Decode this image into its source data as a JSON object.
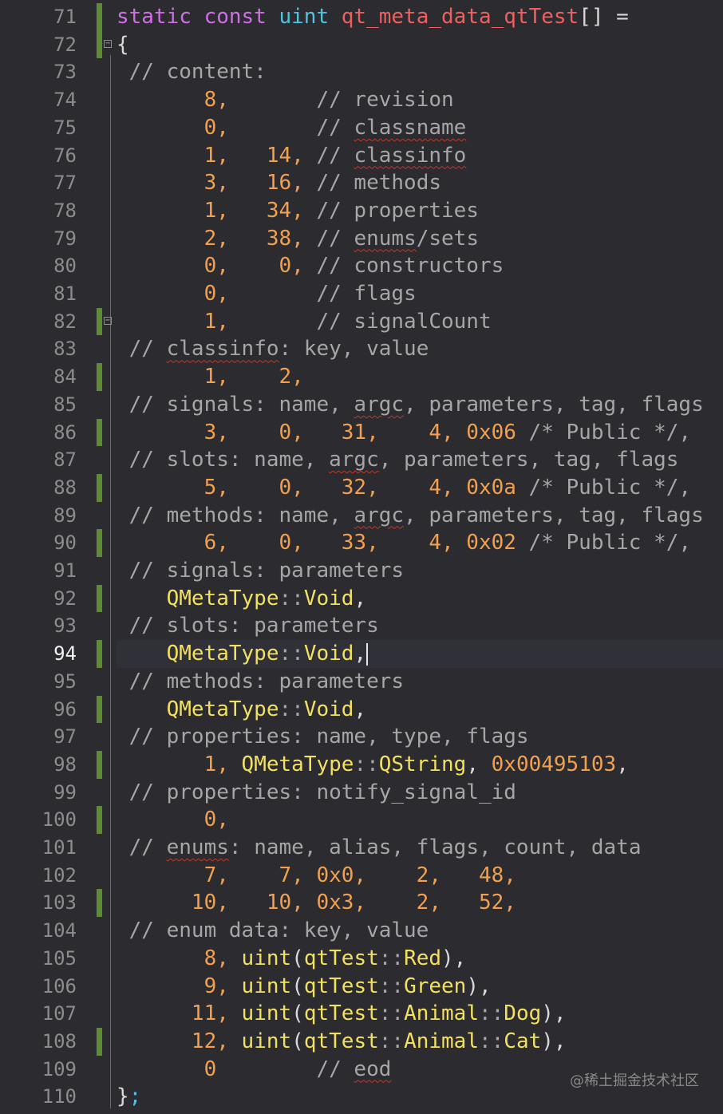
{
  "editor": {
    "current_line": 94,
    "lines": [
      {
        "n": 71,
        "mod": true,
        "tokens": [
          [
            "kw",
            "static const "
          ],
          [
            "ty",
            "uint "
          ],
          [
            "fn",
            "qt_meta_data_qtTest"
          ],
          [
            "punct",
            "[] ="
          ]
        ]
      },
      {
        "n": 72,
        "mod": true,
        "fold": true,
        "tokens": [
          [
            "punct",
            "{"
          ]
        ]
      },
      {
        "n": 73,
        "tokens": [
          [
            "cm",
            " // content:"
          ]
        ]
      },
      {
        "n": 74,
        "tokens": [
          [
            "num",
            "       8,"
          ],
          [
            "cm",
            "       // revision"
          ]
        ]
      },
      {
        "n": 75,
        "tokens": [
          [
            "num",
            "       0,"
          ],
          [
            "cm",
            "       // "
          ],
          [
            "cmsq",
            "classname"
          ]
        ]
      },
      {
        "n": 76,
        "tokens": [
          [
            "num",
            "       1,   14,"
          ],
          [
            "cm",
            " // "
          ],
          [
            "cmsq",
            "classinfo"
          ]
        ]
      },
      {
        "n": 77,
        "tokens": [
          [
            "num",
            "       3,   16,"
          ],
          [
            "cm",
            " // methods"
          ]
        ]
      },
      {
        "n": 78,
        "tokens": [
          [
            "num",
            "       1,   34,"
          ],
          [
            "cm",
            " // properties"
          ]
        ]
      },
      {
        "n": 79,
        "tokens": [
          [
            "num",
            "       2,   38,"
          ],
          [
            "cm",
            " // "
          ],
          [
            "cmsq",
            "enums"
          ],
          [
            "cm",
            "/sets"
          ]
        ]
      },
      {
        "n": 80,
        "tokens": [
          [
            "num",
            "       0,    0,"
          ],
          [
            "cm",
            " // constructors"
          ]
        ]
      },
      {
        "n": 81,
        "tokens": [
          [
            "num",
            "       0,"
          ],
          [
            "cm",
            "       // flags"
          ]
        ]
      },
      {
        "n": 82,
        "mod": true,
        "fold": true,
        "tokens": [
          [
            "num",
            "       1,"
          ],
          [
            "cm",
            "       // signalCount"
          ]
        ]
      },
      {
        "n": 83,
        "tokens": [
          [
            "cm",
            " // "
          ],
          [
            "cmsq",
            "classinfo"
          ],
          [
            "cm",
            ": key, value"
          ]
        ]
      },
      {
        "n": 84,
        "mod": true,
        "tokens": [
          [
            "num",
            "       1,    2,"
          ]
        ]
      },
      {
        "n": 85,
        "tokens": [
          [
            "cm",
            " // signals: name, "
          ],
          [
            "cmsq",
            "argc"
          ],
          [
            "cm",
            ", parameters, tag, flags"
          ]
        ]
      },
      {
        "n": 86,
        "mod": true,
        "tokens": [
          [
            "num",
            "       3,    0,   31,    4, 0x06"
          ],
          [
            "cm",
            " /* Public */,"
          ]
        ]
      },
      {
        "n": 87,
        "tokens": [
          [
            "cm",
            " // slots: name, "
          ],
          [
            "cmsq",
            "argc"
          ],
          [
            "cm",
            ", parameters, tag, flags"
          ]
        ]
      },
      {
        "n": 88,
        "mod": true,
        "tokens": [
          [
            "num",
            "       5,    0,   32,    4, 0x0a"
          ],
          [
            "cm",
            " /* Public */,"
          ]
        ]
      },
      {
        "n": 89,
        "tokens": [
          [
            "cm",
            " // methods: name, "
          ],
          [
            "cmsq",
            "argc"
          ],
          [
            "cm",
            ", parameters, tag, flags"
          ]
        ]
      },
      {
        "n": 90,
        "mod": true,
        "tokens": [
          [
            "num",
            "       6,    0,   33,    4, 0x02"
          ],
          [
            "cm",
            " /* Public */,"
          ]
        ]
      },
      {
        "n": 91,
        "tokens": [
          [
            "cm",
            " // signals: parameters"
          ]
        ]
      },
      {
        "n": 92,
        "mod": true,
        "tokens": [
          [
            "ns",
            "    QMetaType"
          ],
          [
            "cm",
            "::"
          ],
          [
            "ns",
            "Void"
          ],
          [
            "punct",
            ","
          ]
        ]
      },
      {
        "n": 93,
        "tokens": [
          [
            "cm",
            " // slots: parameters"
          ]
        ]
      },
      {
        "n": 94,
        "mod": true,
        "cursor": true,
        "tokens": [
          [
            "ns",
            "    QMetaType"
          ],
          [
            "cm",
            "::"
          ],
          [
            "ns",
            "Void"
          ],
          [
            "punct",
            ","
          ]
        ]
      },
      {
        "n": 95,
        "tokens": [
          [
            "cm",
            " // methods: parameters"
          ]
        ]
      },
      {
        "n": 96,
        "mod": true,
        "tokens": [
          [
            "ns",
            "    QMetaType"
          ],
          [
            "cm",
            "::"
          ],
          [
            "ns",
            "Void"
          ],
          [
            "punct",
            ","
          ]
        ]
      },
      {
        "n": 97,
        "tokens": [
          [
            "cm",
            " // properties: name, type, flags"
          ]
        ]
      },
      {
        "n": 98,
        "mod": true,
        "tokens": [
          [
            "num",
            "       1, "
          ],
          [
            "ns",
            "QMetaType"
          ],
          [
            "cm",
            "::"
          ],
          [
            "ns",
            "QString"
          ],
          [
            "punct",
            ", "
          ],
          [
            "num",
            "0x00495103"
          ],
          [
            "punct",
            ","
          ]
        ]
      },
      {
        "n": 99,
        "tokens": [
          [
            "cm",
            " // properties: notify_signal_id"
          ]
        ]
      },
      {
        "n": 100,
        "mod": true,
        "tokens": [
          [
            "num",
            "       0,"
          ]
        ]
      },
      {
        "n": 101,
        "tokens": [
          [
            "cm",
            " // "
          ],
          [
            "cmsq",
            "enums"
          ],
          [
            "cm",
            ": name, alias, flags, count, data"
          ]
        ]
      },
      {
        "n": 102,
        "tokens": [
          [
            "num",
            "       7,    7, 0x0,    2,   48,"
          ]
        ]
      },
      {
        "n": 103,
        "mod": true,
        "tokens": [
          [
            "num",
            "      10,   10, 0x3,    2,   52,"
          ]
        ]
      },
      {
        "n": 104,
        "tokens": [
          [
            "cm",
            " // enum data: key, value"
          ]
        ]
      },
      {
        "n": 105,
        "tokens": [
          [
            "num",
            "       8, "
          ],
          [
            "ns",
            "uint"
          ],
          [
            "punct",
            "("
          ],
          [
            "ns",
            "qtTest"
          ],
          [
            "cm",
            "::"
          ],
          [
            "ns",
            "Red"
          ],
          [
            "punct",
            "),"
          ]
        ]
      },
      {
        "n": 106,
        "tokens": [
          [
            "num",
            "       9, "
          ],
          [
            "ns",
            "uint"
          ],
          [
            "punct",
            "("
          ],
          [
            "ns",
            "qtTest"
          ],
          [
            "cm",
            "::"
          ],
          [
            "ns",
            "Green"
          ],
          [
            "punct",
            "),"
          ]
        ]
      },
      {
        "n": 107,
        "tokens": [
          [
            "num",
            "      11, "
          ],
          [
            "ns",
            "uint"
          ],
          [
            "punct",
            "("
          ],
          [
            "ns",
            "qtTest"
          ],
          [
            "cm",
            "::"
          ],
          [
            "ns",
            "Animal"
          ],
          [
            "cm",
            "::"
          ],
          [
            "ns",
            "Dog"
          ],
          [
            "punct",
            "),"
          ]
        ]
      },
      {
        "n": 108,
        "mod": true,
        "tokens": [
          [
            "num",
            "      12, "
          ],
          [
            "ns",
            "uint"
          ],
          [
            "punct",
            "("
          ],
          [
            "ns",
            "qtTest"
          ],
          [
            "cm",
            "::"
          ],
          [
            "ns",
            "Animal"
          ],
          [
            "cm",
            "::"
          ],
          [
            "ns",
            "Cat"
          ],
          [
            "punct",
            "),"
          ]
        ]
      },
      {
        "n": 109,
        "tokens": [
          [
            "num",
            "       0"
          ],
          [
            "cm",
            "        // "
          ],
          [
            "cmsq",
            "eod"
          ]
        ]
      },
      {
        "n": 110,
        "tokens": [
          [
            "punct",
            "}"
          ],
          [
            "ty",
            ";"
          ]
        ]
      }
    ]
  },
  "watermark": "@稀土掘金技术社区"
}
